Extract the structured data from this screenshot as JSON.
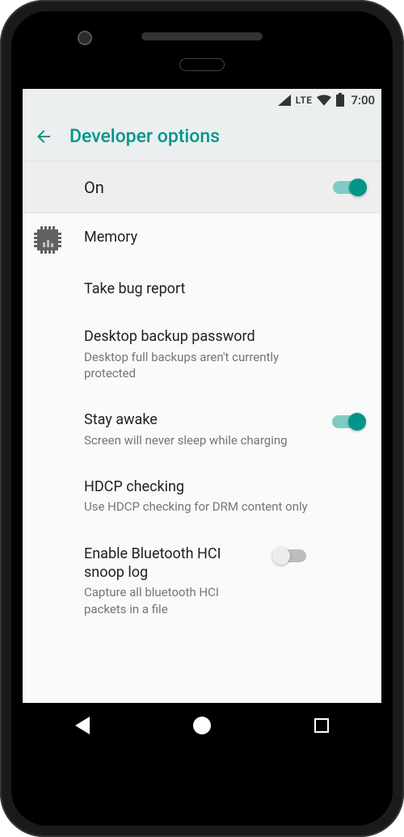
{
  "status_bar": {
    "network_label": "LTE",
    "clock": "7:00"
  },
  "header": {
    "title": "Developer options"
  },
  "master": {
    "label": "On",
    "enabled": true
  },
  "items": [
    {
      "icon": "memory",
      "title": "Memory",
      "subtitle": null,
      "toggle": null
    },
    {
      "icon": null,
      "title": "Take bug report",
      "subtitle": null,
      "toggle": null
    },
    {
      "icon": null,
      "title": "Desktop backup password",
      "subtitle": "Desktop full backups aren't currently protected",
      "toggle": null
    },
    {
      "icon": null,
      "title": "Stay awake",
      "subtitle": "Screen will never sleep while charging",
      "toggle": true
    },
    {
      "icon": null,
      "title": "HDCP checking",
      "subtitle": "Use HDCP checking for DRM content only",
      "toggle": null
    },
    {
      "icon": null,
      "title": "Enable Bluetooth HCI snoop log",
      "subtitle": "Capture all bluetooth HCI packets in a file",
      "toggle": false
    }
  ]
}
